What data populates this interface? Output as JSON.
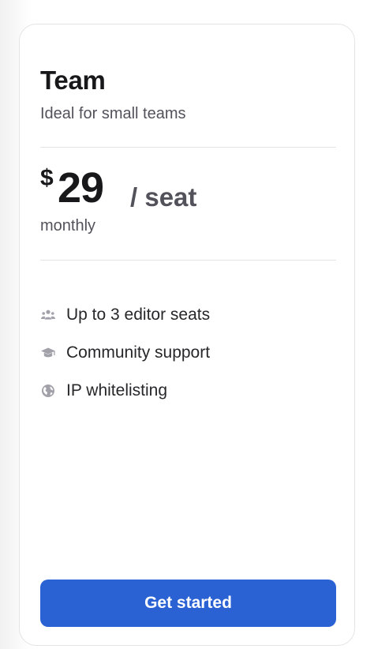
{
  "plan": {
    "name": "Team",
    "description": "Ideal for small teams",
    "currency": "$",
    "price": "29",
    "per": "/ seat",
    "billing": "monthly"
  },
  "features": [
    {
      "icon": "users-icon",
      "label": "Up to 3 editor seats"
    },
    {
      "icon": "graduation-cap-icon",
      "label": "Community support"
    },
    {
      "icon": "globe-icon",
      "label": "IP whitelisting"
    }
  ],
  "cta": {
    "label": "Get started"
  },
  "colors": {
    "accent": "#2a62d4",
    "heading": "#18181b",
    "muted": "#52525b",
    "icon": "#a1a1aa",
    "divider": "#e4e4e7"
  }
}
